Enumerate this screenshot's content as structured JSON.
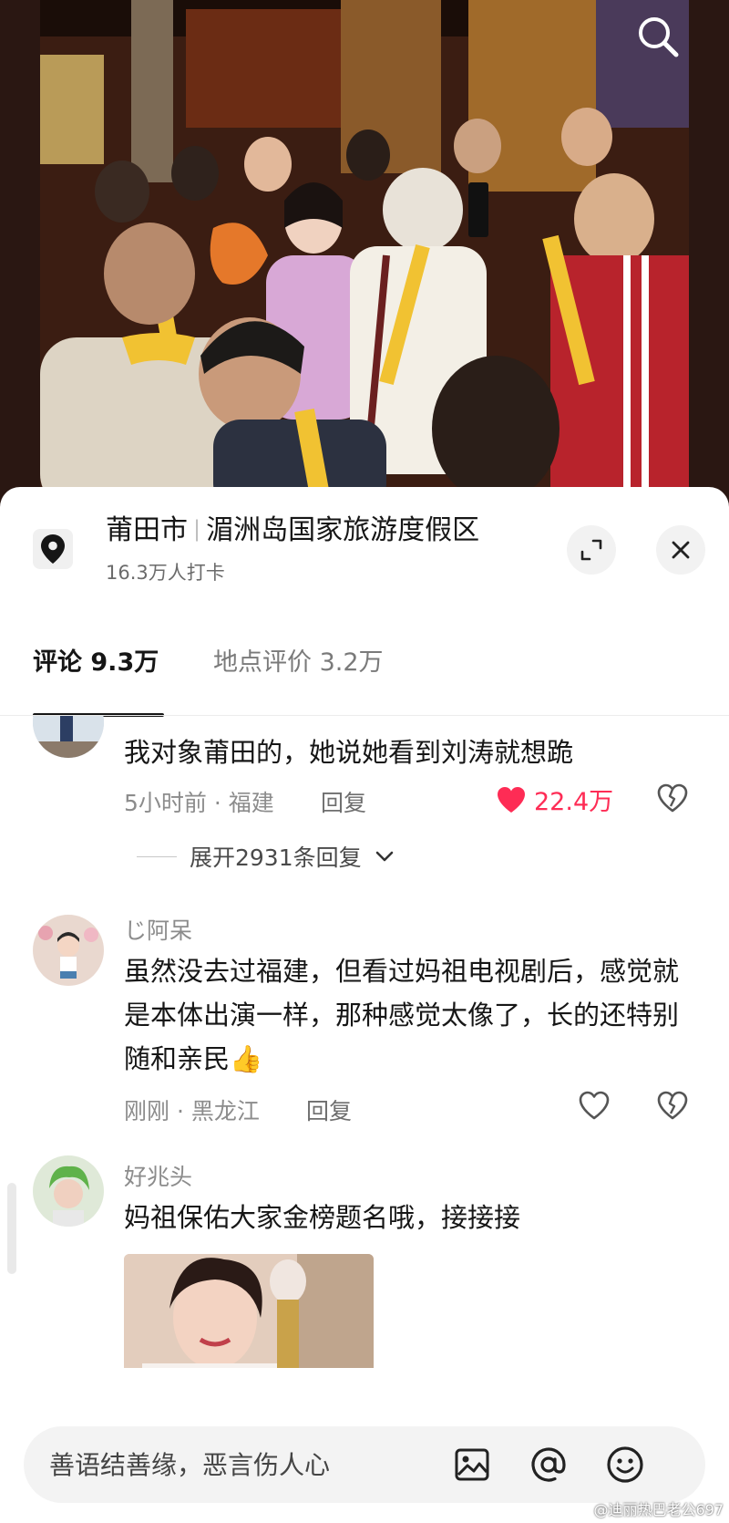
{
  "location": {
    "city": "莆田市",
    "area": "湄洲岛国家旅游度假区",
    "checkins": "16.3万人打卡"
  },
  "tabs": [
    {
      "label": "评论 9.3万",
      "active": true
    },
    {
      "label": "地点评价 3.2万",
      "active": false
    }
  ],
  "comments": [
    {
      "text": "我对象莆田的，她说她看到刘涛就想跪",
      "time_location": "5小时前 · 福建",
      "reply_label": "回复",
      "likes": "22.4万",
      "liked": true,
      "expand_replies": "展开2931条回复"
    },
    {
      "username": "じ阿呆",
      "text": "虽然没去过福建，但看过妈祖电视剧后，感觉就是本体出演一样，那种感觉太像了，长的还特别随和亲民👍",
      "time_location": "刚刚 · 黑龙江",
      "reply_label": "回复",
      "liked": false
    },
    {
      "username": "好兆头",
      "text": "妈祖保佑大家金榜题名哦，接接接",
      "has_image": true
    }
  ],
  "input": {
    "placeholder": "善语结善缘，恶言伤人心"
  },
  "watermark": "@迪丽热巴老公697",
  "colors": {
    "like_active": "#fe2c55",
    "text_primary": "#161616",
    "text_secondary": "#8c8c8c"
  },
  "icons": [
    "search-icon",
    "location-pin-icon",
    "expand-icon",
    "close-icon",
    "heart-icon",
    "dislike-heart-icon",
    "chevron-down-icon",
    "image-icon",
    "at-icon",
    "emoji-icon"
  ]
}
